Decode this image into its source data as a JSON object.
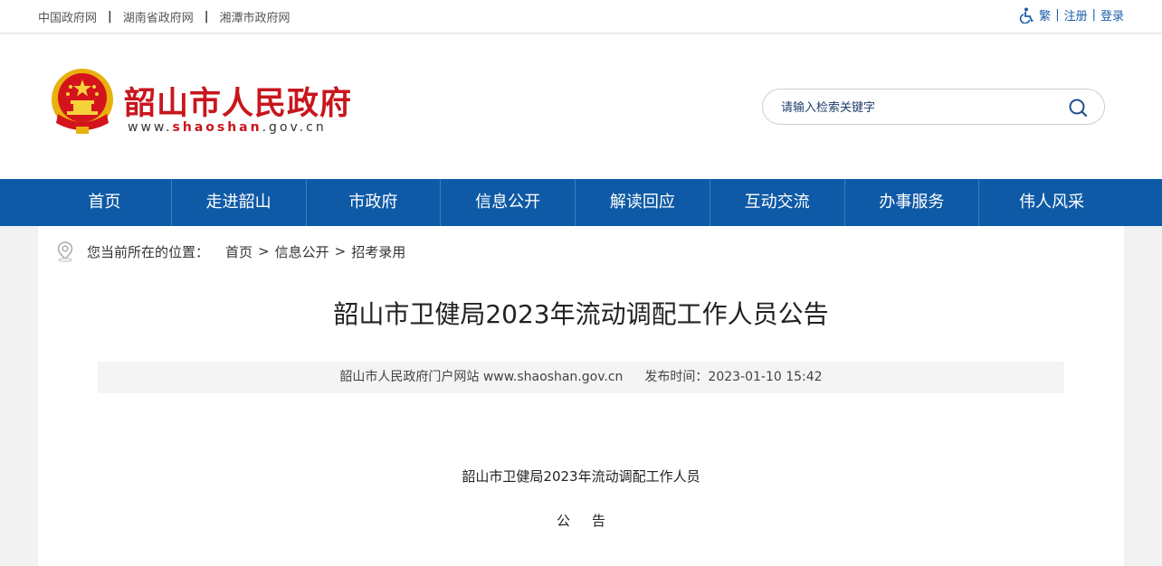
{
  "topbar": {
    "links": [
      "中国政府网",
      "湖南省政府网",
      "湘潭市政府网"
    ],
    "separator": "|",
    "right": {
      "traditional": "繁",
      "register": "注册",
      "login": "登录",
      "bar": "|"
    }
  },
  "header": {
    "title": "韶山市人民政府",
    "url_prefix": "www.",
    "url_highlight": "shaoshan",
    "url_suffix": ".gov.cn",
    "search_placeholder": "请输入检索关键字"
  },
  "nav": {
    "items": [
      "首页",
      "走进韶山",
      "市政府",
      "信息公开",
      "解读回应",
      "互动交流",
      "办事服务",
      "伟人风采"
    ]
  },
  "breadcrumb": {
    "label": "您当前所在的位置：",
    "items": [
      "首页",
      "信息公开",
      "招考录用"
    ],
    "arrow": ">"
  },
  "article": {
    "title": "韶山市卫健局2023年流动调配工作人员公告",
    "source": "韶山市人民政府门户网站 www.shaoshan.gov.cn",
    "published": "发布时间：2023-01-10 15:42",
    "body_line1": "韶山市卫健局2023年流动调配工作人员",
    "body_line2": "公告"
  },
  "colors": {
    "brand_red": "#c8161d",
    "nav_blue": "#0f5aa6",
    "link_blue": "#1a5ca8"
  }
}
